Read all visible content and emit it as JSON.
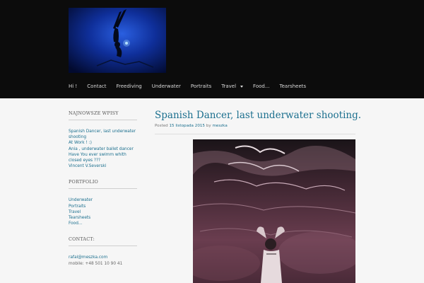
{
  "nav": {
    "items": [
      "Hi !",
      "Contact",
      "Freediving",
      "Underwater",
      "Portraits",
      "Travel",
      "Food...",
      "Tearsheets"
    ]
  },
  "sidebar": {
    "recent": {
      "title": "NAJNOWSZE WPISY",
      "items": [
        "Spanish Dancer, last underwater shooting",
        "At Work ! :)",
        "Ania , underwater ballet dancer",
        "Have You ever swimm whith closed eyes ???",
        "Vincent V.Severski"
      ]
    },
    "portfolio": {
      "title": "PORTFOLIO",
      "items": [
        "Underwater",
        "Portraits",
        "Travel",
        "Tearsheets",
        "Food..."
      ]
    },
    "contact": {
      "title": "CONTACT:",
      "email": "rafal@meszka.com",
      "mobile": "mobile: +48 501 10 90 41"
    }
  },
  "post": {
    "title": "Spanish Dancer, last underwater shooting.",
    "meta_prefix": "Posted",
    "date": "15 listopada 2015",
    "meta_by": "by",
    "author": "meszka"
  },
  "colors": {
    "header_bg": "#0c0c0c",
    "page_bg": "#f6f6f6",
    "link": "#1b6f8e"
  }
}
